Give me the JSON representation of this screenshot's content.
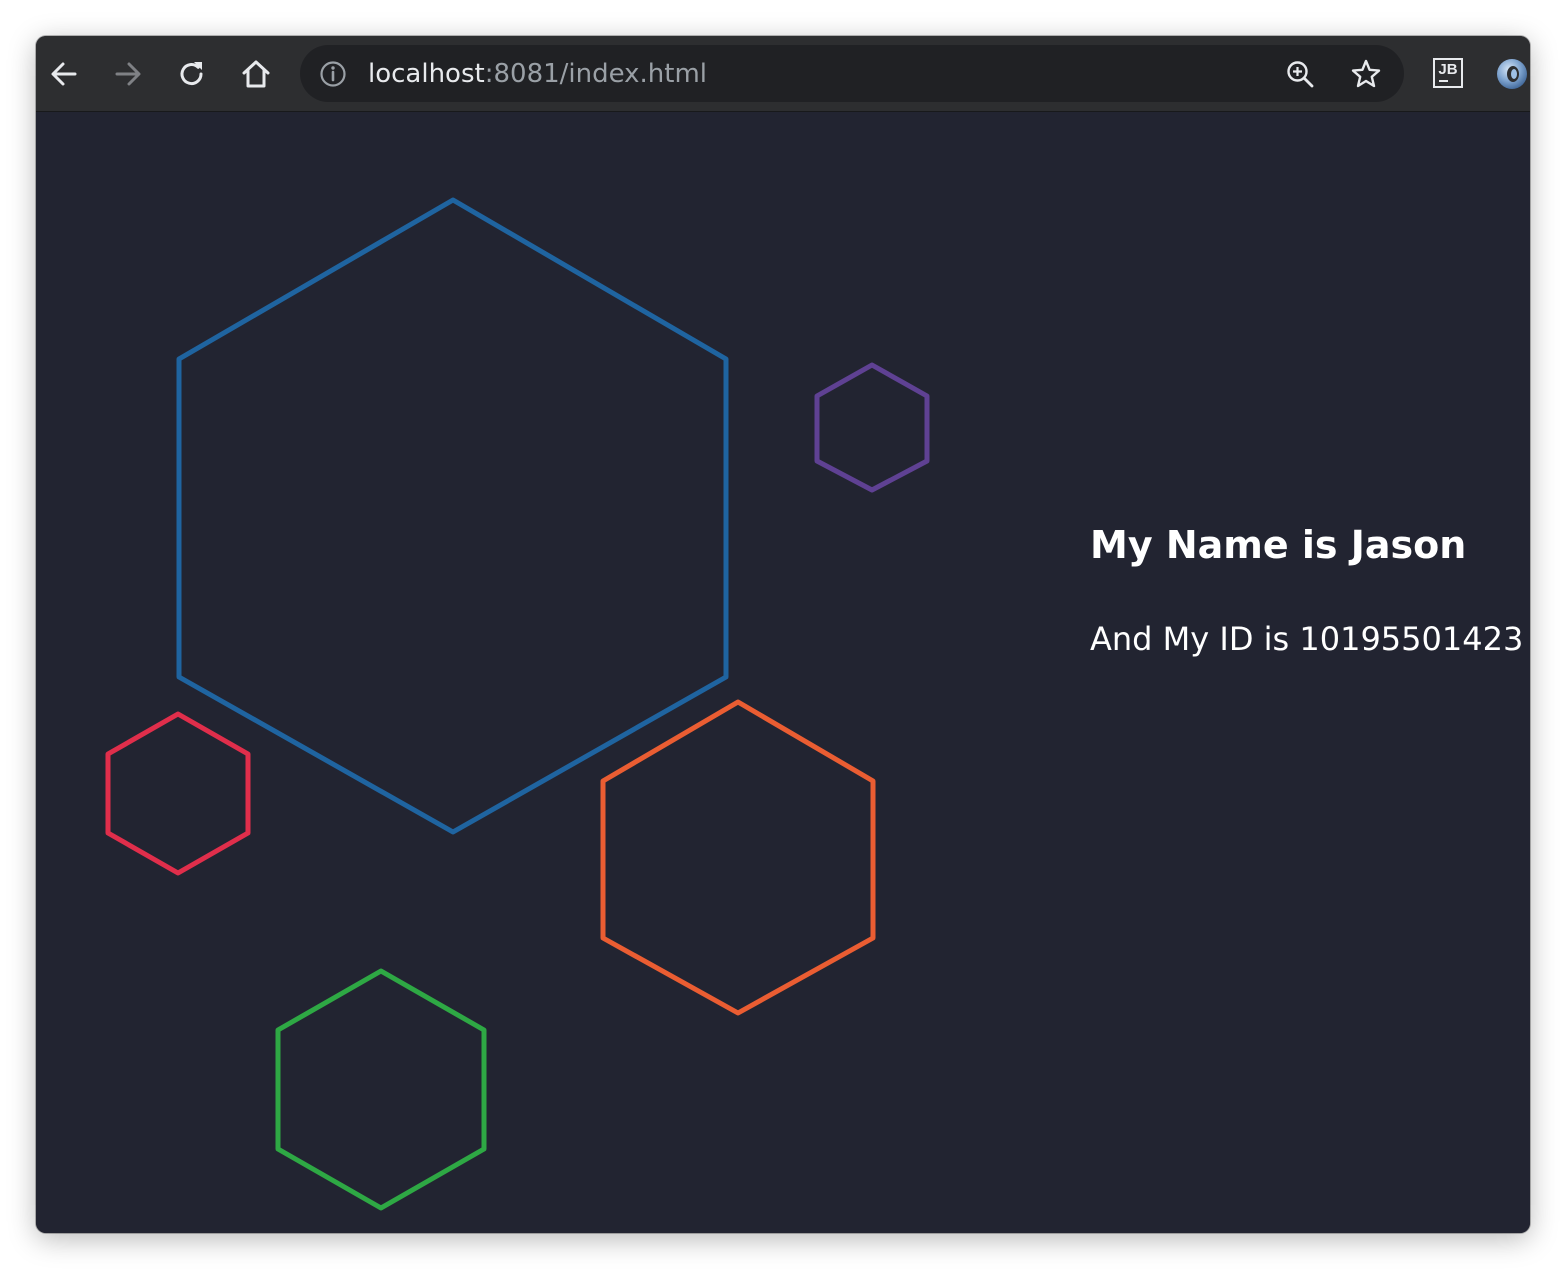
{
  "browser": {
    "url_host": "localhost",
    "url_rest": ":8081/index.html",
    "extensions": [
      {
        "name": "jetbrains-extension",
        "label": "JB"
      },
      {
        "name": "ring-extension",
        "label": ""
      }
    ]
  },
  "page": {
    "background_color": "#222431",
    "heading": "My Name is Jason",
    "id_line": "And My ID is 10195501423",
    "hexagons": [
      {
        "name": "blue-hexagon",
        "color": "#1f64a0"
      },
      {
        "name": "purple-hexagon",
        "color": "#5f4193"
      },
      {
        "name": "red-hexagon",
        "color": "#e02e4b"
      },
      {
        "name": "orange-hexagon",
        "color": "#ea5d32"
      },
      {
        "name": "green-hexagon",
        "color": "#2ea844"
      }
    ]
  }
}
